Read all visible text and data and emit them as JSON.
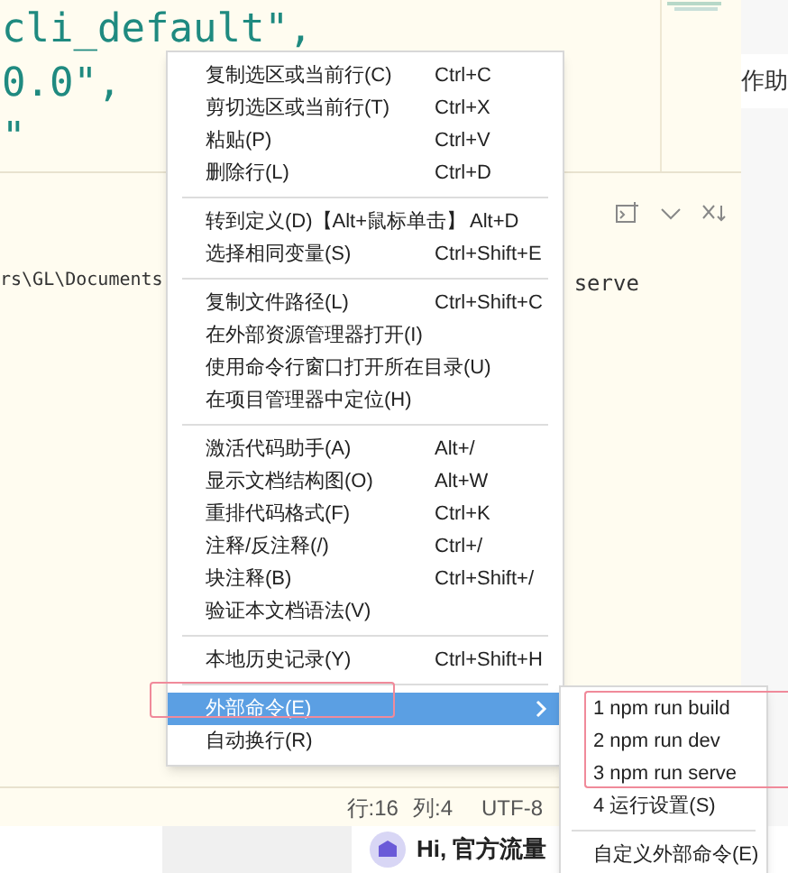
{
  "editor": {
    "code_lines": [
      "cli_default\",",
      "0.0\",",
      "\""
    ]
  },
  "side_text": "作助",
  "terminal": {
    "path": "rs\\GL\\Documents",
    "command_tail": "serve"
  },
  "status_bar": {
    "line": "行:16",
    "column": "列:4",
    "encoding": "UTF-8"
  },
  "context_menu": {
    "groups": [
      [
        {
          "label": "复制选区或当前行(C)",
          "shortcut": "Ctrl+C",
          "selected": false,
          "has_submenu": false
        },
        {
          "label": "剪切选区或当前行(T)",
          "shortcut": "Ctrl+X",
          "selected": false,
          "has_submenu": false
        },
        {
          "label": "粘贴(P)",
          "shortcut": "Ctrl+V",
          "selected": false,
          "has_submenu": false
        },
        {
          "label": "删除行(L)",
          "shortcut": "Ctrl+D",
          "selected": false,
          "has_submenu": false
        }
      ],
      [
        {
          "label": "转到定义(D)【Alt+鼠标单击】",
          "shortcut": "Alt+D",
          "selected": false,
          "has_submenu": false
        },
        {
          "label": "选择相同变量(S)",
          "shortcut": "Ctrl+Shift+E",
          "selected": false,
          "has_submenu": false
        }
      ],
      [
        {
          "label": "复制文件路径(L)",
          "shortcut": "Ctrl+Shift+C",
          "selected": false,
          "has_submenu": false
        },
        {
          "label": "在外部资源管理器打开(I)",
          "selected": false,
          "has_submenu": false
        },
        {
          "label": "使用命令行窗口打开所在目录(U)",
          "selected": false,
          "has_submenu": false
        },
        {
          "label": "在项目管理器中定位(H)",
          "selected": false,
          "has_submenu": false
        }
      ],
      [
        {
          "label": "激活代码助手(A)",
          "shortcut": "Alt+/",
          "selected": false,
          "has_submenu": false
        },
        {
          "label": "显示文档结构图(O)",
          "shortcut": "Alt+W",
          "selected": false,
          "has_submenu": false
        },
        {
          "label": "重排代码格式(F)",
          "shortcut": "Ctrl+K",
          "selected": false,
          "has_submenu": false
        },
        {
          "label": "注释/反注释(/)",
          "shortcut": "Ctrl+/",
          "selected": false,
          "has_submenu": false
        },
        {
          "label": "块注释(B)",
          "shortcut": "Ctrl+Shift+/",
          "selected": false,
          "has_submenu": false
        },
        {
          "label": "验证本文档语法(V)",
          "selected": false,
          "has_submenu": false
        }
      ],
      [
        {
          "label": "本地历史记录(Y)",
          "shortcut": "Ctrl+Shift+H",
          "selected": false,
          "has_submenu": false
        }
      ],
      [
        {
          "label": "外部命令(E)",
          "selected": true,
          "has_submenu": true
        },
        {
          "label": "自动换行(R)",
          "selected": false,
          "has_submenu": false
        }
      ]
    ]
  },
  "submenu": {
    "groups": [
      [
        {
          "label": "1 npm run build"
        },
        {
          "label": "2 npm run dev"
        },
        {
          "label": "3 npm run serve"
        },
        {
          "label": "4 运行设置(S)"
        }
      ],
      [
        {
          "label": "自定义外部命令(E)"
        }
      ]
    ]
  },
  "banner": {
    "text": "Hi, 官方流量"
  }
}
